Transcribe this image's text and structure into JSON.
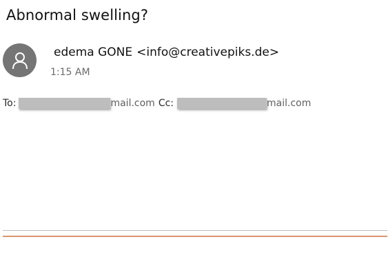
{
  "message": {
    "subject": "Abnormal swelling?",
    "sender_name": "edema GONE",
    "sender_email": "<info@creativepiks.de>",
    "time": "1:15 AM",
    "to_label": "To:",
    "to_visible": "mail.com",
    "cc_label": "Cc:",
    "cc_visible": "mail.com"
  },
  "icons": {
    "avatar": "person-icon"
  },
  "colors": {
    "avatar_bg": "#757575",
    "accent_line": "#d9956c",
    "divider": "#b9bec3"
  }
}
